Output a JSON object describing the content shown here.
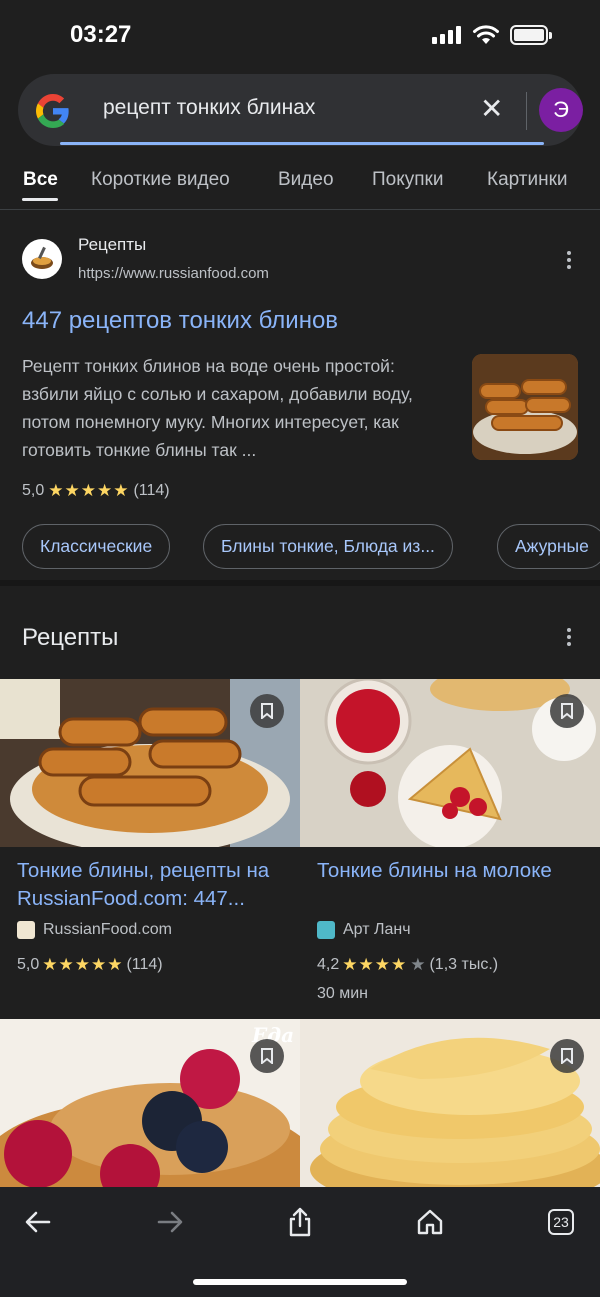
{
  "status_bar": {
    "time": "03:27"
  },
  "search": {
    "query": "рецепт тонких блинах",
    "avatar_letter": "Э"
  },
  "tabs": [
    {
      "label": "Все",
      "active": true
    },
    {
      "label": "Короткие видео"
    },
    {
      "label": "Видео"
    },
    {
      "label": "Покупки"
    },
    {
      "label": "Картинки"
    }
  ],
  "result": {
    "site_name": "Рецепты",
    "site_url": "https://www.russianfood.com",
    "title": "447 рецептов тонких блинов",
    "snippet": "Рецепт тонких блинов на воде очень простой: взбили яйцо с солью и сахаром, добавили воду, потом понемногу муку. Многих интересует, как готовить тонкие блины так ...",
    "rating": "5,0",
    "stars": "★★★★★",
    "reviews": "(114)",
    "chips": [
      "Классические",
      "Блины тонкие, Блюда из...",
      "Ажурные"
    ]
  },
  "recipes": {
    "section_title": "Рецепты",
    "cards": [
      {
        "title": "Тонкие блины, рецепты на RussianFood.com: 447...",
        "source": "RussianFood.com",
        "rating": "5,0",
        "stars": "★★★★★",
        "stars_off": "",
        "reviews": "(114)",
        "time": ""
      },
      {
        "title": "Тонкие блины на молоке",
        "source": "Арт Ланч",
        "rating": "4,2",
        "stars": "★★★★",
        "stars_off": "★",
        "reviews": "(1,3 тыс.)",
        "time": "30 мин"
      },
      {
        "watermark": "Eда"
      },
      {}
    ]
  },
  "bottom_bar": {
    "tab_count": "23"
  },
  "colors": {
    "background": "#1f1f1f",
    "link": "#8ab4f8",
    "star": "#fdd663",
    "avatar": "#7b1fa2"
  }
}
